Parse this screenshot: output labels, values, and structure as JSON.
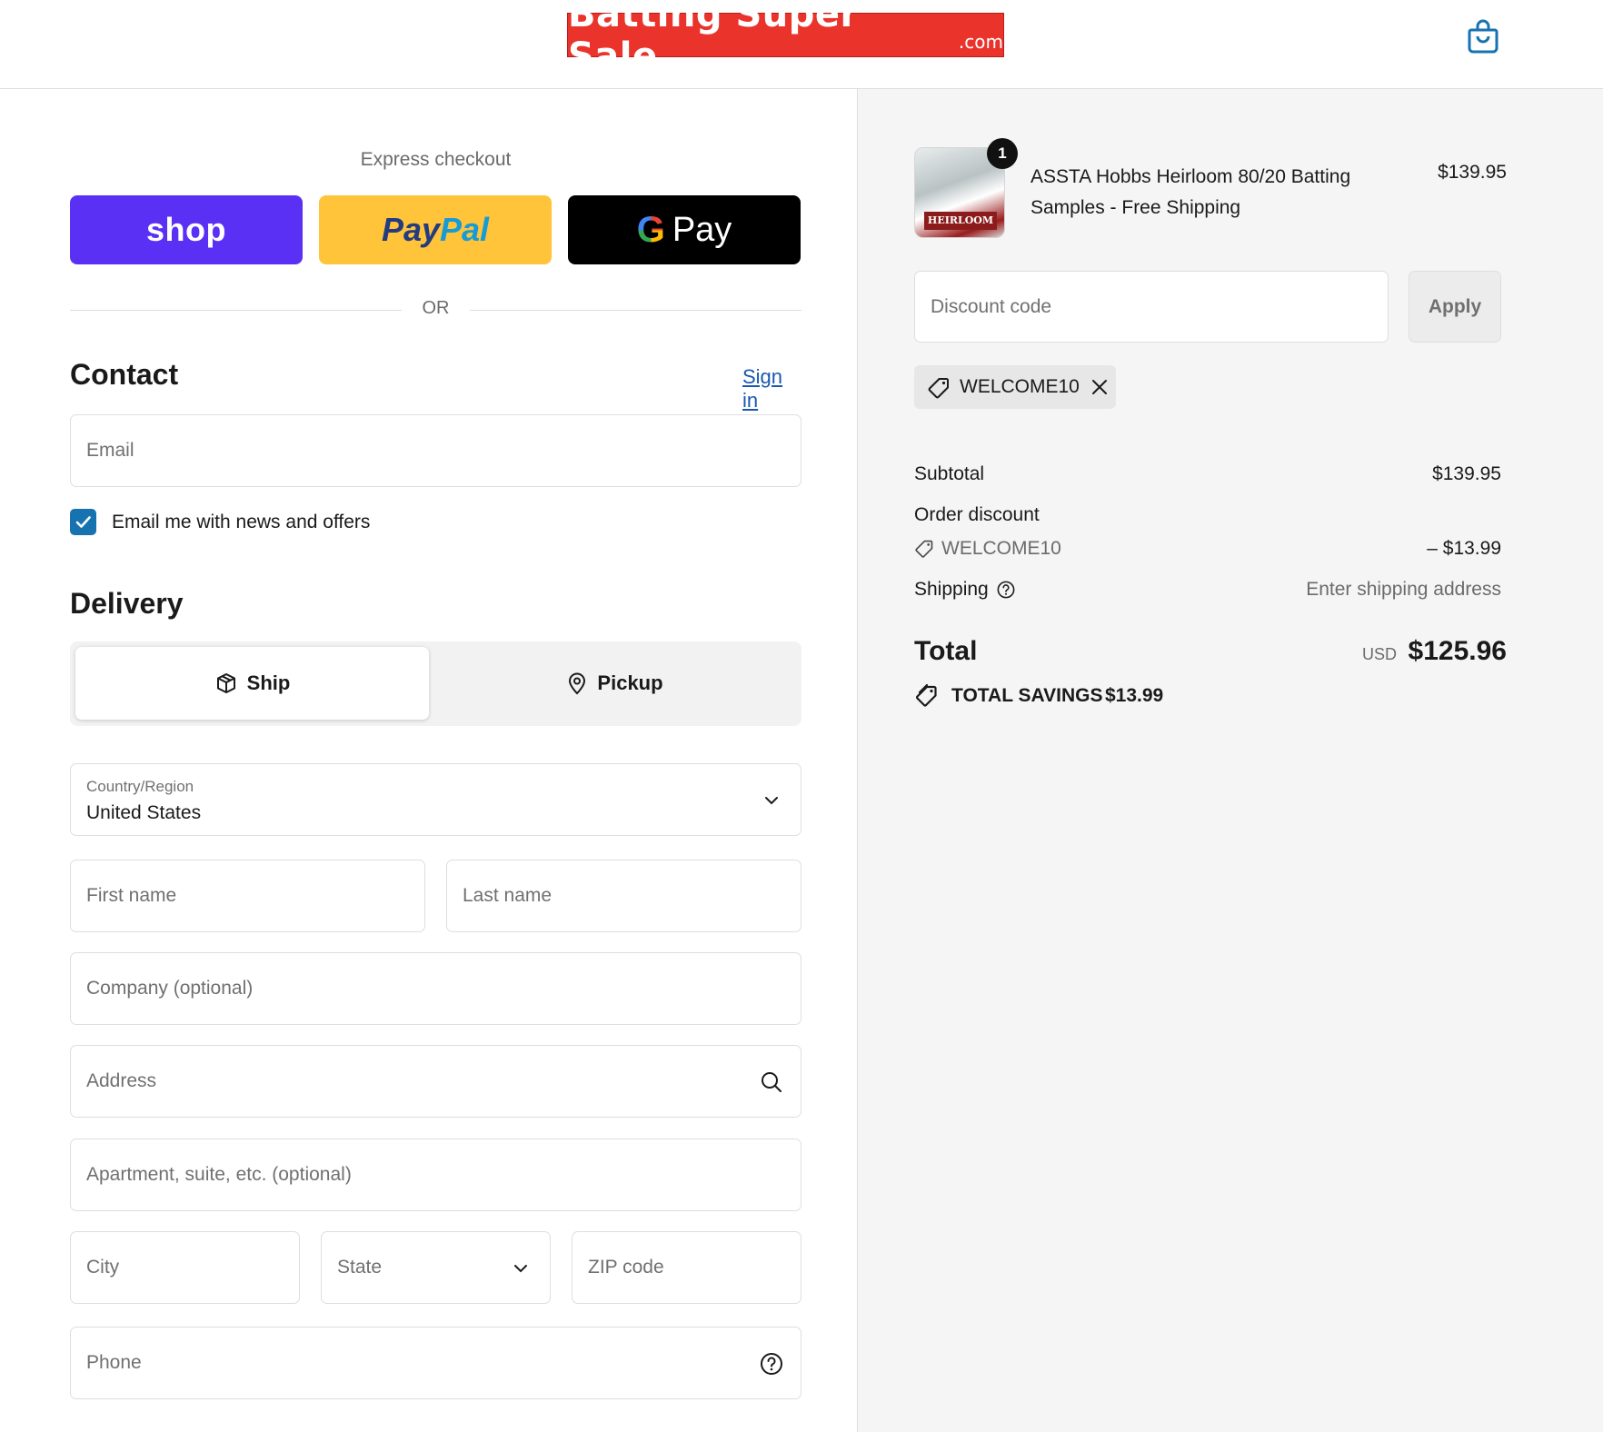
{
  "header": {
    "logo_main": "Batting Super Sale",
    "logo_domain": ".com",
    "cart_icon": "shopping-bag-icon"
  },
  "express": {
    "title": "Express checkout",
    "shop_label": "shop",
    "paypal_label_1": "Pay",
    "paypal_label_2": "Pal",
    "gpay_g": "G",
    "gpay_label": "Pay",
    "or_text": "OR"
  },
  "contact": {
    "title": "Contact",
    "sign_in": "Sign in",
    "email_placeholder": "Email",
    "news_checkbox_label": "Email me with news and offers",
    "news_checked": true
  },
  "delivery": {
    "title": "Delivery",
    "ship_label": "Ship",
    "pickup_label": "Pickup",
    "country_label": "Country/Region",
    "country_value": "United States",
    "first_name": "First name",
    "last_name": "Last name",
    "company": "Company (optional)",
    "address": "Address",
    "apartment": "Apartment, suite, etc. (optional)",
    "city": "City",
    "state": "State",
    "zip": "ZIP code",
    "phone": "Phone"
  },
  "summary": {
    "item": {
      "quantity": "1",
      "name": "ASSTA Hobbs Heirloom 80/20 Batting Samples - Free Shipping",
      "price": "$139.95",
      "thumb_text": "HEIRLOOM"
    },
    "discount_placeholder": "Discount code",
    "apply_label": "Apply",
    "applied_code": "WELCOME10",
    "subtotal_label": "Subtotal",
    "subtotal_value": "$139.95",
    "order_discount_label": "Order discount",
    "discount_code": "WELCOME10",
    "discount_value": "– $13.99",
    "shipping_label": "Shipping",
    "shipping_value": "Enter shipping address",
    "total_label": "Total",
    "total_currency": "USD",
    "total_value": "$125.96",
    "savings_label": "TOTAL SAVINGS",
    "savings_value": "$13.99"
  },
  "colors": {
    "accent": "#1773b0",
    "shop": "#5a31f4",
    "paypal": "#ffc439",
    "logo_red": "#e9332b"
  }
}
